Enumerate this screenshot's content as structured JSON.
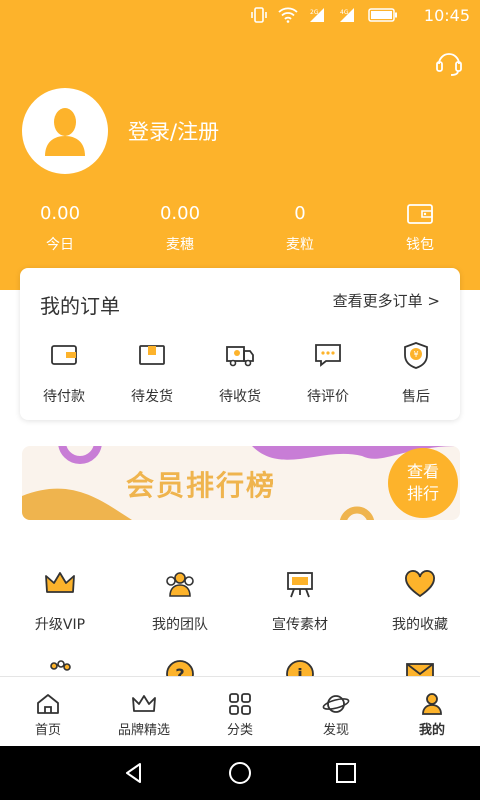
{
  "status_bar": {
    "time": "10:45",
    "icons": [
      "vibrate-icon",
      "wifi-icon",
      "signal-2g-icon",
      "signal-4g-icon",
      "battery-icon"
    ]
  },
  "header": {
    "support_icon": "headset-icon",
    "login_label": "登录/注册",
    "accent_color": "#FDB32B"
  },
  "stats": [
    {
      "value": "0.00",
      "label": "今日"
    },
    {
      "value": "0.00",
      "label": "麦穗"
    },
    {
      "value": "0",
      "label": "麦粒"
    },
    {
      "value": "",
      "label": "钱包",
      "icon": "wallet-icon"
    }
  ],
  "orders": {
    "title": "我的订单",
    "more": "查看更多订单 >",
    "items": [
      {
        "label": "待付款",
        "icon": "wallet-icon"
      },
      {
        "label": "待发货",
        "icon": "package-icon"
      },
      {
        "label": "待收货",
        "icon": "truck-icon"
      },
      {
        "label": "待评价",
        "icon": "comment-icon"
      },
      {
        "label": "售后",
        "icon": "shield-icon"
      }
    ]
  },
  "banner": {
    "text": "会员排行榜",
    "button_line1": "查看",
    "button_line2": "排行"
  },
  "functions": [
    {
      "label": "升级VIP",
      "icon": "crown-icon"
    },
    {
      "label": "我的团队",
      "icon": "team-icon"
    },
    {
      "label": "宣传素材",
      "icon": "easel-icon"
    },
    {
      "label": "我的收藏",
      "icon": "heart-icon"
    }
  ],
  "functions_row2_icons": [
    "gift-icon",
    "help-icon",
    "info-icon",
    "mail-icon"
  ],
  "tabbar": [
    {
      "label": "首页",
      "icon": "home-icon"
    },
    {
      "label": "品牌精选",
      "icon": "crown-icon"
    },
    {
      "label": "分类",
      "icon": "grid-icon"
    },
    {
      "label": "发现",
      "icon": "planet-icon"
    },
    {
      "label": "我的",
      "icon": "user-icon",
      "active": true
    }
  ]
}
